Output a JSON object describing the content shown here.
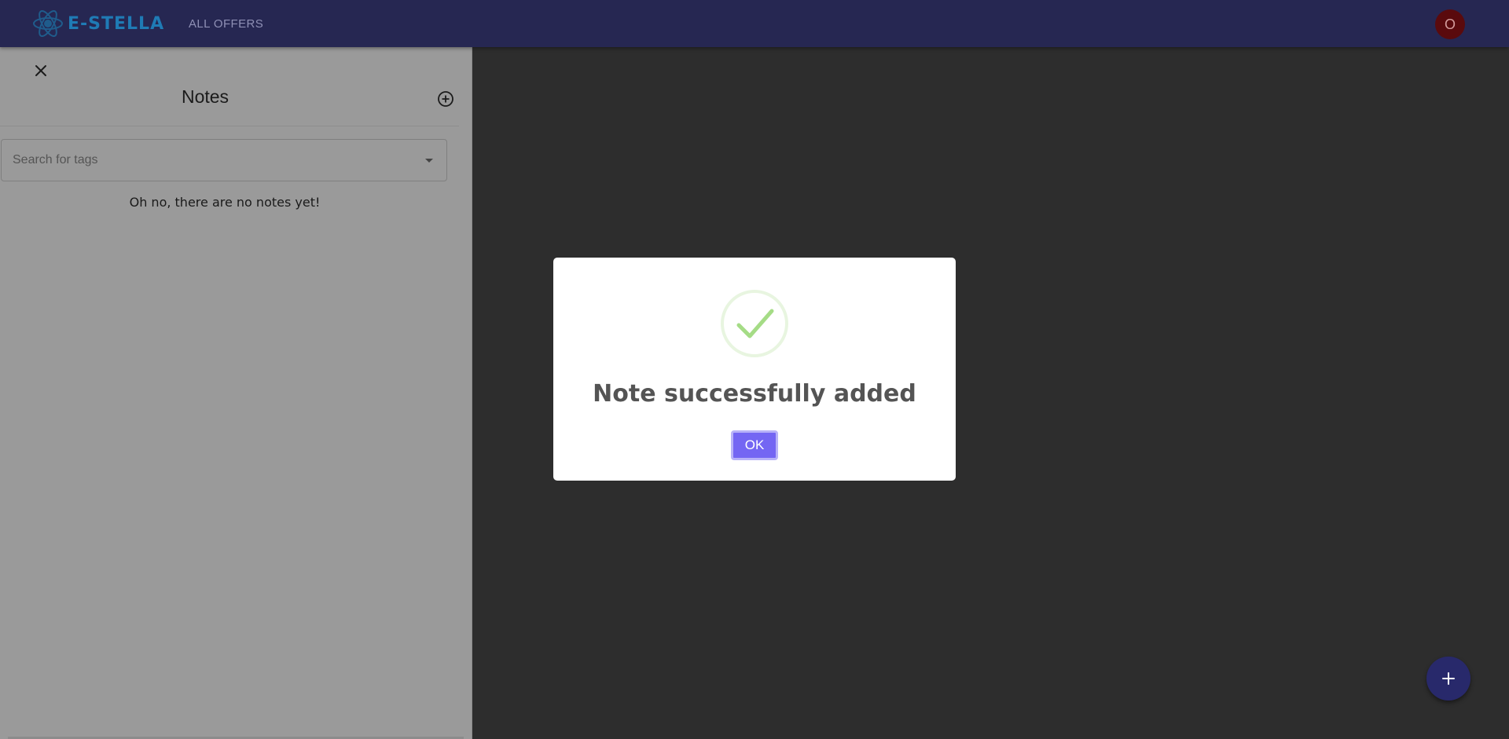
{
  "appbar": {
    "logo_text": "E-STELLA",
    "nav_offers": "ALL OFFERS",
    "avatar_initial": "O"
  },
  "drawer": {
    "title": "Notes",
    "search_placeholder": "Search for tags",
    "empty_message": "Oh no, there are no notes yet!"
  },
  "modal": {
    "title": "Note successfully added",
    "ok_label": "OK"
  },
  "icons": {
    "close": "close-icon",
    "add_note": "add-circle-icon",
    "dropdown": "caret-down-icon",
    "success": "check-icon",
    "fab": "plus-icon"
  },
  "colors": {
    "appbar": "#262752",
    "ok_button": "#7466f3",
    "success": "#a5dc86",
    "fab": "#28296b"
  }
}
